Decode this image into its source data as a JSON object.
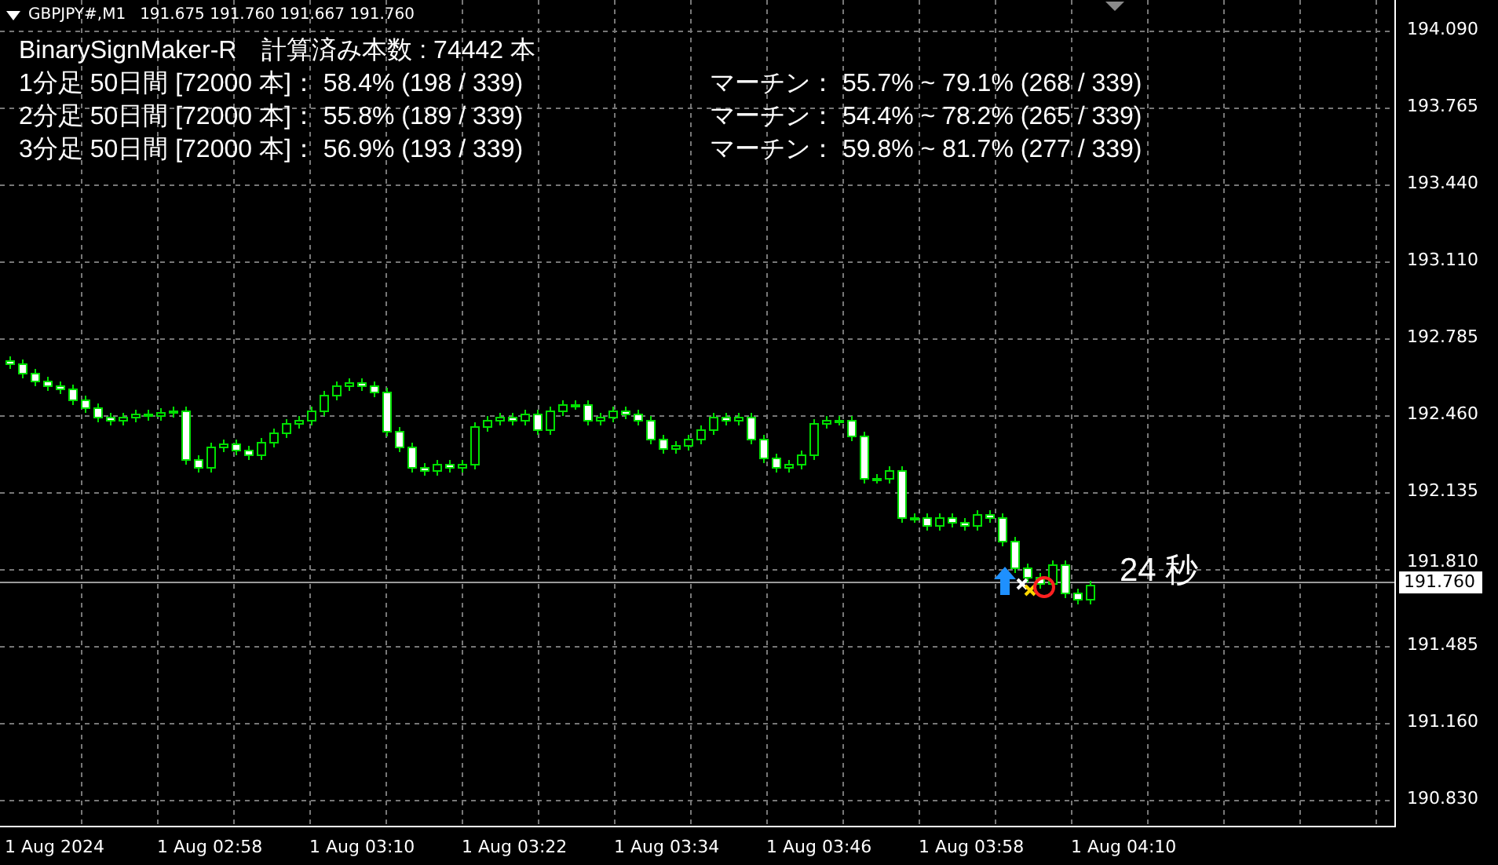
{
  "symbol_header": {
    "title": "GBPJPY#,M1",
    "quote": "191.675 191.760 191.667 191.760"
  },
  "indicator": {
    "name": "BinarySignMaker-R",
    "count": "計算済み本数 : 74442 本",
    "rows": [
      {
        "stats": "1分足 50日間 [72000 本]：  58.4% (198 / 339)",
        "martingale": "マーチン：  55.7% ~ 79.1% (268 / 339)"
      },
      {
        "stats": "2分足 50日間 [72000 本]：  55.8% (189 / 339)",
        "martingale": "マーチン：  54.4% ~ 78.2% (265 / 339)"
      },
      {
        "stats": "3分足 50日間 [72000 本]：  56.9% (193 / 339)",
        "martingale": "マーチン：  59.8% ~ 81.7% (277 / 339)"
      }
    ]
  },
  "countdown": "24 秒",
  "price_axis": {
    "ticks": [
      "194.090",
      "193.765",
      "193.440",
      "193.110",
      "192.785",
      "192.460",
      "192.135",
      "191.810",
      "191.485",
      "191.160",
      "190.830"
    ],
    "current_price": "191.760"
  },
  "time_axis": {
    "labels": [
      "1 Aug 2024",
      "1 Aug 02:58",
      "1 Aug 03:10",
      "1 Aug 03:22",
      "1 Aug 03:34",
      "1 Aug 03:46",
      "1 Aug 03:58",
      "1 Aug 04:10"
    ]
  }
}
